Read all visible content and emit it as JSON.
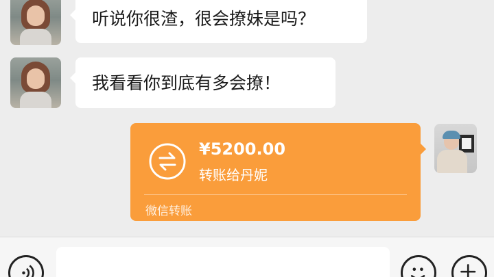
{
  "messages": [
    {
      "sender": "other",
      "text": "听说你很渣，很会撩妹是吗？"
    },
    {
      "sender": "other",
      "text": "我看看你到底有多会撩！"
    }
  ],
  "transfer": {
    "amount": "¥5200.00",
    "recipient_text": "转账给丹妮",
    "footer": "微信转账",
    "color": "#fa9d3b",
    "icon": "transfer-arrows-icon"
  },
  "input_bar": {
    "placeholder": "",
    "voice_icon": "voice-icon",
    "emoji_icon": "emoji-icon",
    "plus_icon": "plus-icon"
  }
}
